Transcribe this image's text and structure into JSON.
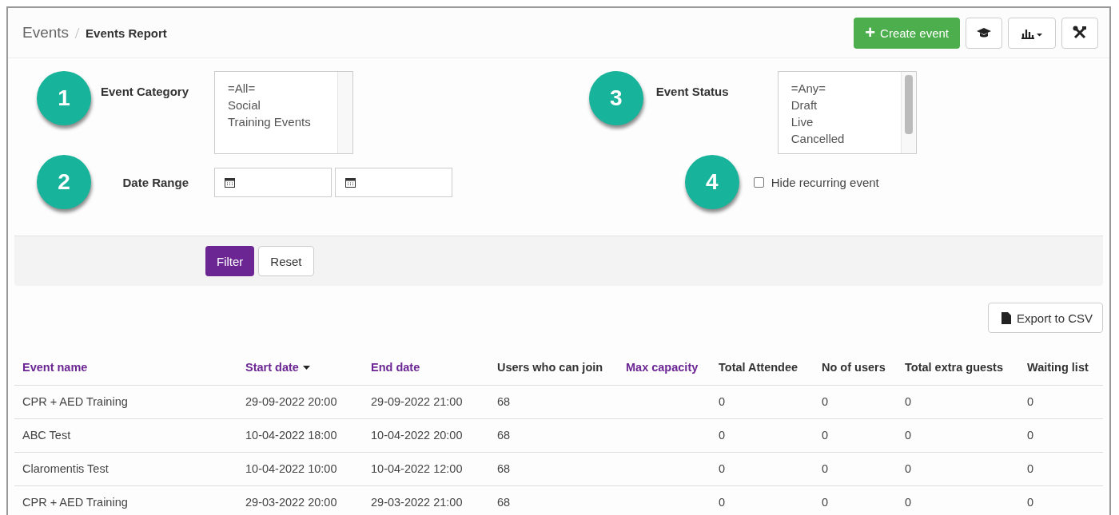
{
  "breadcrumb": [
    {
      "label": "Events",
      "current": false
    },
    {
      "label": "Events Report",
      "current": true
    }
  ],
  "toolbar": {
    "create_button": "Create event",
    "plus": "+"
  },
  "filters": {
    "category": {
      "badge": "1",
      "label": "Event Category",
      "options": [
        "=All=",
        "Social",
        "Training Events"
      ]
    },
    "date_range": {
      "badge": "2",
      "label": "Date Range"
    },
    "status": {
      "badge": "3",
      "label": "Event Status",
      "options": [
        "=Any=",
        "Draft",
        "Live",
        "Cancelled"
      ]
    },
    "recurring": {
      "badge": "4",
      "label": "Hide recurring event",
      "checked": false
    }
  },
  "actions": {
    "filter": "Filter",
    "reset": "Reset"
  },
  "export_button": "Export to CSV",
  "table": {
    "columns": [
      {
        "label": "Event name",
        "sortable": true,
        "sorted": false
      },
      {
        "label": "Start date",
        "sortable": true,
        "sorted": true
      },
      {
        "label": "End date",
        "sortable": true,
        "sorted": false
      },
      {
        "label": "Users who can join",
        "sortable": false,
        "sorted": false
      },
      {
        "label": "Max capacity",
        "sortable": true,
        "sorted": false
      },
      {
        "label": "Total Attendee",
        "sortable": false,
        "sorted": false
      },
      {
        "label": "No of users",
        "sortable": false,
        "sorted": false
      },
      {
        "label": "Total extra guests",
        "sortable": false,
        "sorted": false
      },
      {
        "label": "Waiting list",
        "sortable": false,
        "sorted": false
      }
    ],
    "rows": [
      [
        "CPR + AED Training",
        "29-09-2022 20:00",
        "29-09-2022 21:00",
        "68",
        "",
        "0",
        "0",
        "0",
        "0"
      ],
      [
        "ABC Test",
        "10-04-2022 18:00",
        "10-04-2022 20:00",
        "68",
        "",
        "0",
        "0",
        "0",
        "0"
      ],
      [
        "Claromentis Test",
        "10-04-2022 10:00",
        "10-04-2022 12:00",
        "68",
        "",
        "0",
        "0",
        "0",
        "0"
      ],
      [
        "CPR + AED Training",
        "29-03-2022 20:00",
        "29-03-2022 21:00",
        "68",
        "",
        "0",
        "0",
        "0",
        "0"
      ]
    ]
  }
}
